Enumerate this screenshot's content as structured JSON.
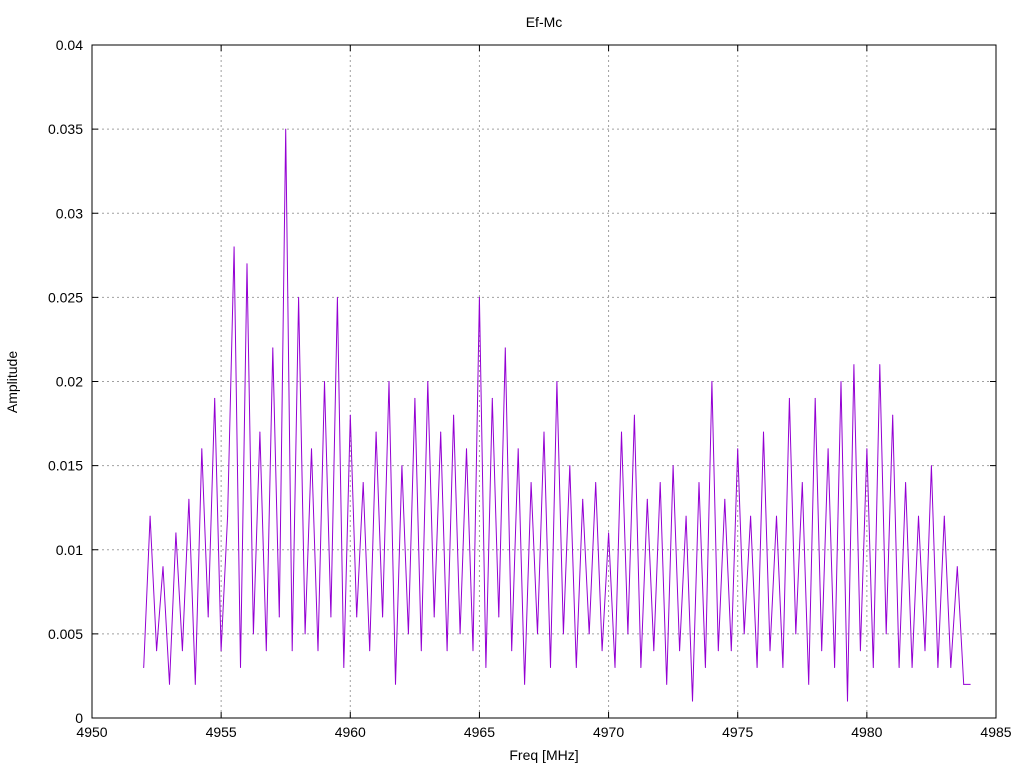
{
  "chart_data": {
    "type": "line",
    "title": "Ef-Mc",
    "xlabel": "Freq [MHz]",
    "ylabel": "Amplitude",
    "xlim": [
      4950,
      4985
    ],
    "ylim": [
      0,
      0.04
    ],
    "xticks": [
      "4950",
      "4955",
      "4960",
      "4965",
      "4970",
      "4975",
      "4980",
      "4985"
    ],
    "yticks": [
      "0",
      "0.005",
      "0.01",
      "0.015",
      "0.02",
      "0.025",
      "0.03",
      "0.035",
      "0.04"
    ],
    "grid": true,
    "series": [
      {
        "name": "Ef-Mc",
        "color": "#9400d3",
        "x_start": 4952,
        "x_step": 0.25,
        "values": [
          0.003,
          0.012,
          0.004,
          0.009,
          0.002,
          0.011,
          0.004,
          0.013,
          0.002,
          0.016,
          0.006,
          0.019,
          0.004,
          0.012,
          0.028,
          0.003,
          0.027,
          0.005,
          0.017,
          0.004,
          0.022,
          0.006,
          0.035,
          0.004,
          0.025,
          0.005,
          0.016,
          0.004,
          0.02,
          0.006,
          0.025,
          0.003,
          0.018,
          0.006,
          0.014,
          0.004,
          0.017,
          0.006,
          0.02,
          0.002,
          0.015,
          0.005,
          0.019,
          0.004,
          0.02,
          0.006,
          0.017,
          0.004,
          0.018,
          0.005,
          0.016,
          0.004,
          0.025,
          0.003,
          0.019,
          0.006,
          0.022,
          0.004,
          0.016,
          0.002,
          0.014,
          0.005,
          0.017,
          0.003,
          0.02,
          0.005,
          0.015,
          0.003,
          0.013,
          0.005,
          0.014,
          0.004,
          0.011,
          0.003,
          0.017,
          0.005,
          0.018,
          0.003,
          0.013,
          0.004,
          0.014,
          0.002,
          0.015,
          0.004,
          0.012,
          0.001,
          0.014,
          0.003,
          0.02,
          0.004,
          0.013,
          0.004,
          0.016,
          0.005,
          0.012,
          0.003,
          0.017,
          0.004,
          0.012,
          0.003,
          0.019,
          0.005,
          0.014,
          0.002,
          0.019,
          0.004,
          0.016,
          0.003,
          0.02,
          0.001,
          0.021,
          0.004,
          0.016,
          0.003,
          0.021,
          0.005,
          0.018,
          0.003,
          0.014,
          0.003,
          0.012,
          0.004,
          0.015,
          0.003,
          0.012,
          0.003,
          0.009,
          0.002,
          0.002
        ]
      }
    ]
  }
}
